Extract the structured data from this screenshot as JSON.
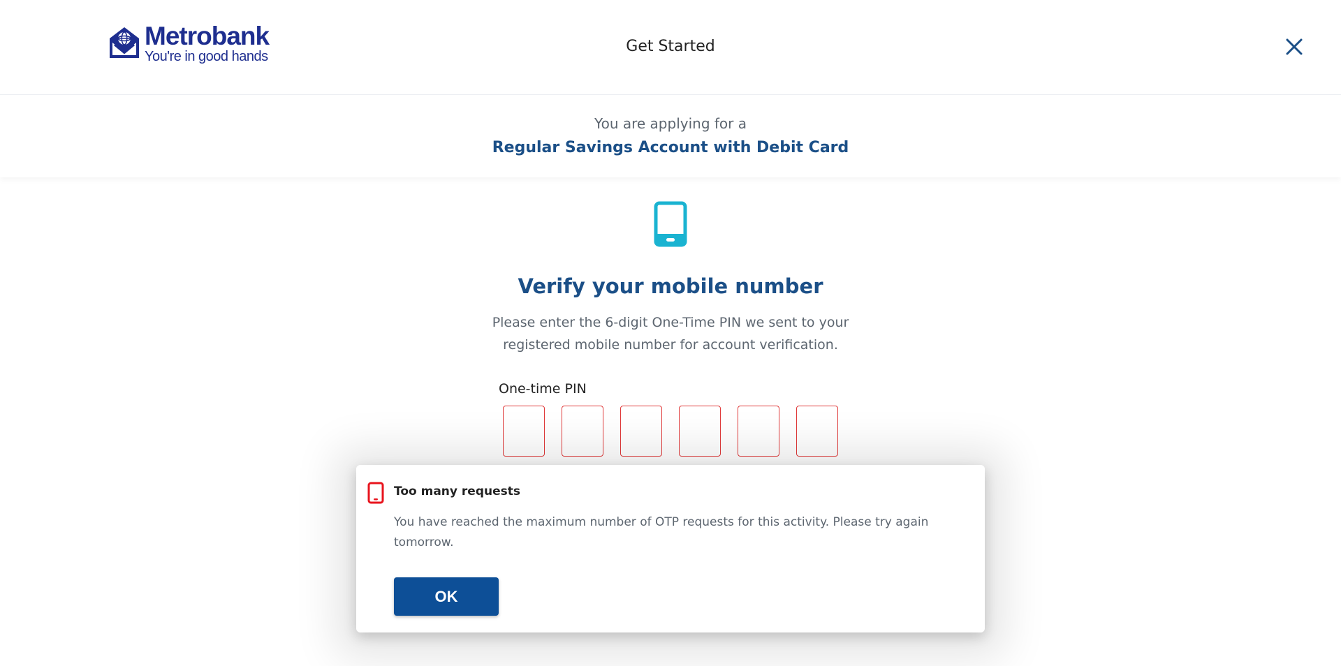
{
  "header": {
    "logo": {
      "name": "Metrobank",
      "tagline": "You're in good hands"
    },
    "title": "Get Started",
    "close_icon": "close-icon"
  },
  "application": {
    "intro": "You are applying for a",
    "product": "Regular Savings Account with Debit Card"
  },
  "verify": {
    "icon": "mobile-phone-icon",
    "title": "Verify your mobile number",
    "description": "Please enter the 6-digit One-Time PIN we sent to your registered mobile number for account verification.",
    "pin_label": "One-time PIN",
    "pin_digits": [
      "",
      "",
      "",
      "",
      "",
      ""
    ]
  },
  "dialog": {
    "icon": "mobile-phone-icon",
    "title": "Too many requests",
    "message": "You have reached the maximum number of OTP requests for this activity. Please try again tomorrow.",
    "ok_label": "OK"
  },
  "colors": {
    "brand_blue": "#1e2e8f",
    "heading_blue": "#1b4f87",
    "button_blue": "#0d4f97",
    "phone_icon_cyan": "#1ab3d1",
    "error_red": "#e03a3a"
  }
}
